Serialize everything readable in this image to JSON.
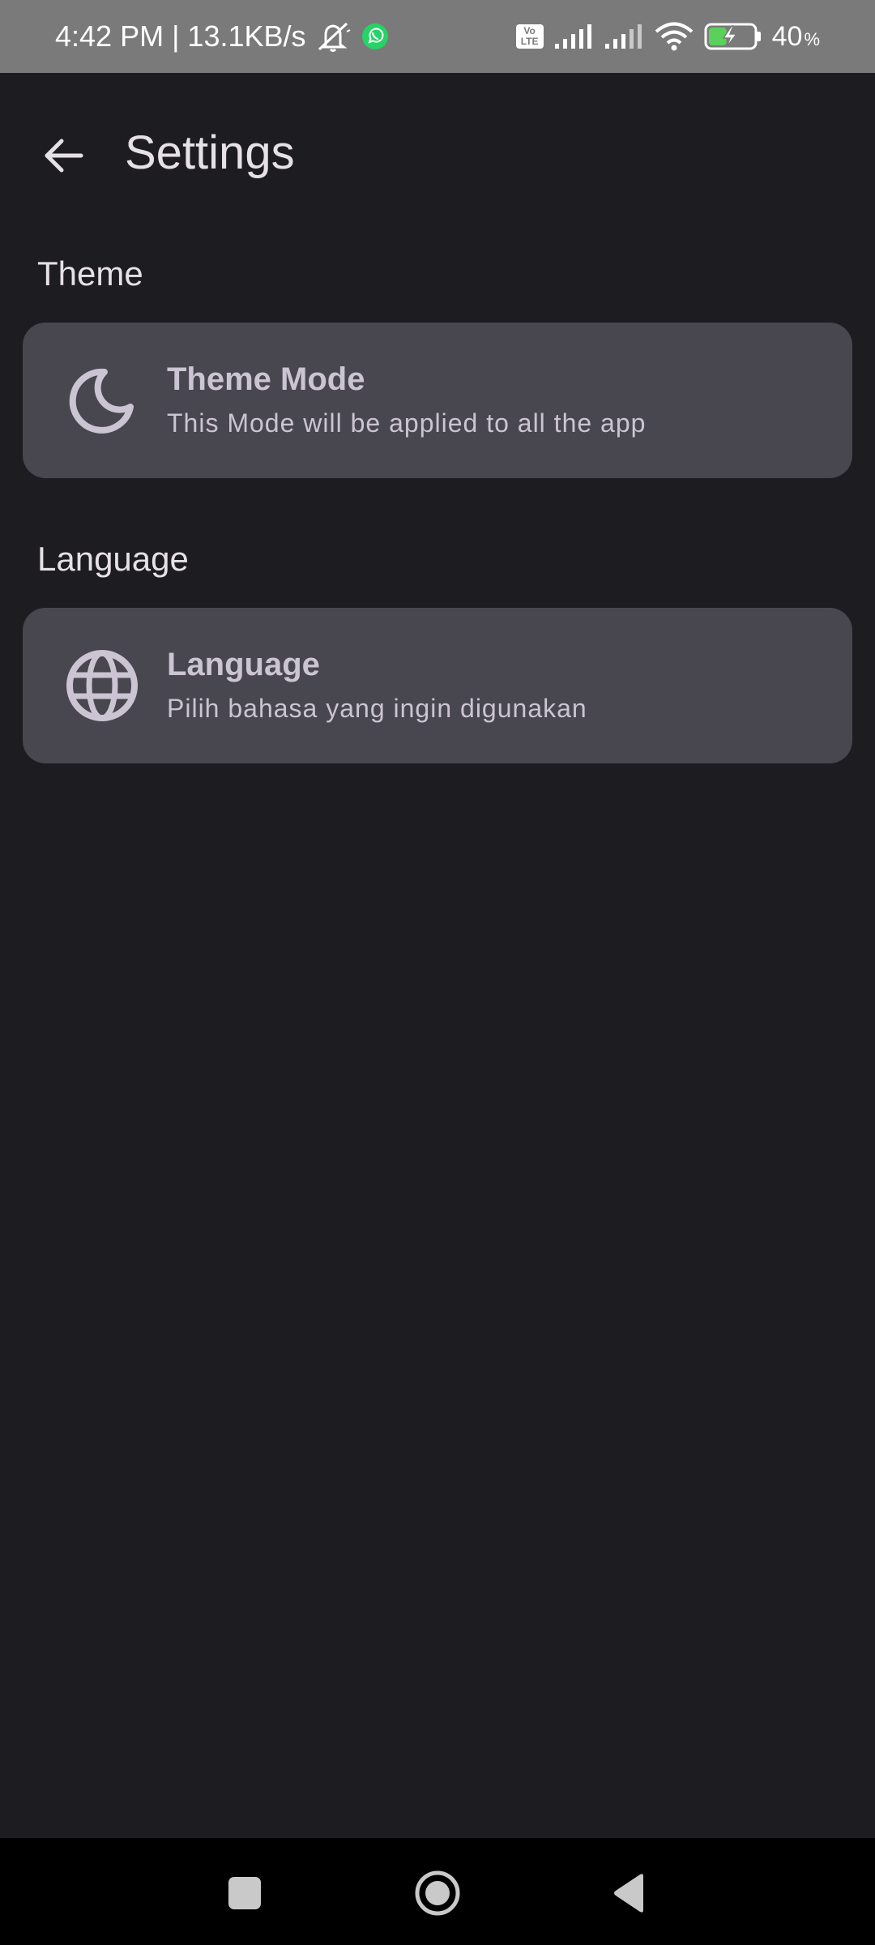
{
  "status_bar": {
    "time_speed": "4:42 PM | 13.1KB/s",
    "volte_top": "Vo",
    "volte_bottom": "LTE",
    "battery_level": "40",
    "battery_unit": "%",
    "battery_fill": 0.4,
    "icons": [
      "mute-icon",
      "whatsapp-icon",
      "volte-icon",
      "signal-icon",
      "signal-icon",
      "wifi-icon",
      "battery-icon"
    ]
  },
  "app_bar": {
    "title": "Settings",
    "back_icon": "arrow-back-icon"
  },
  "sections": [
    {
      "label": "Theme",
      "item": {
        "icon": "moon-icon",
        "title": "Theme Mode",
        "subtitle": "This Mode will be applied to all the app"
      }
    },
    {
      "label": "Language",
      "item": {
        "icon": "globe-icon",
        "title": "Language",
        "subtitle": "Pilih bahasa yang ingin digunakan"
      }
    }
  ],
  "colors": {
    "background": "#1d1c21",
    "card": "#48464e",
    "text_primary": "#e6e1e6",
    "text_card": "#cbc4d2",
    "status_bar": "#7a7a7a",
    "battery_charging": "#5ad15a",
    "whatsapp": "#25d366"
  },
  "nav_bar": {
    "buttons": [
      "recents-square-icon",
      "home-circle-icon",
      "back-triangle-icon"
    ]
  }
}
